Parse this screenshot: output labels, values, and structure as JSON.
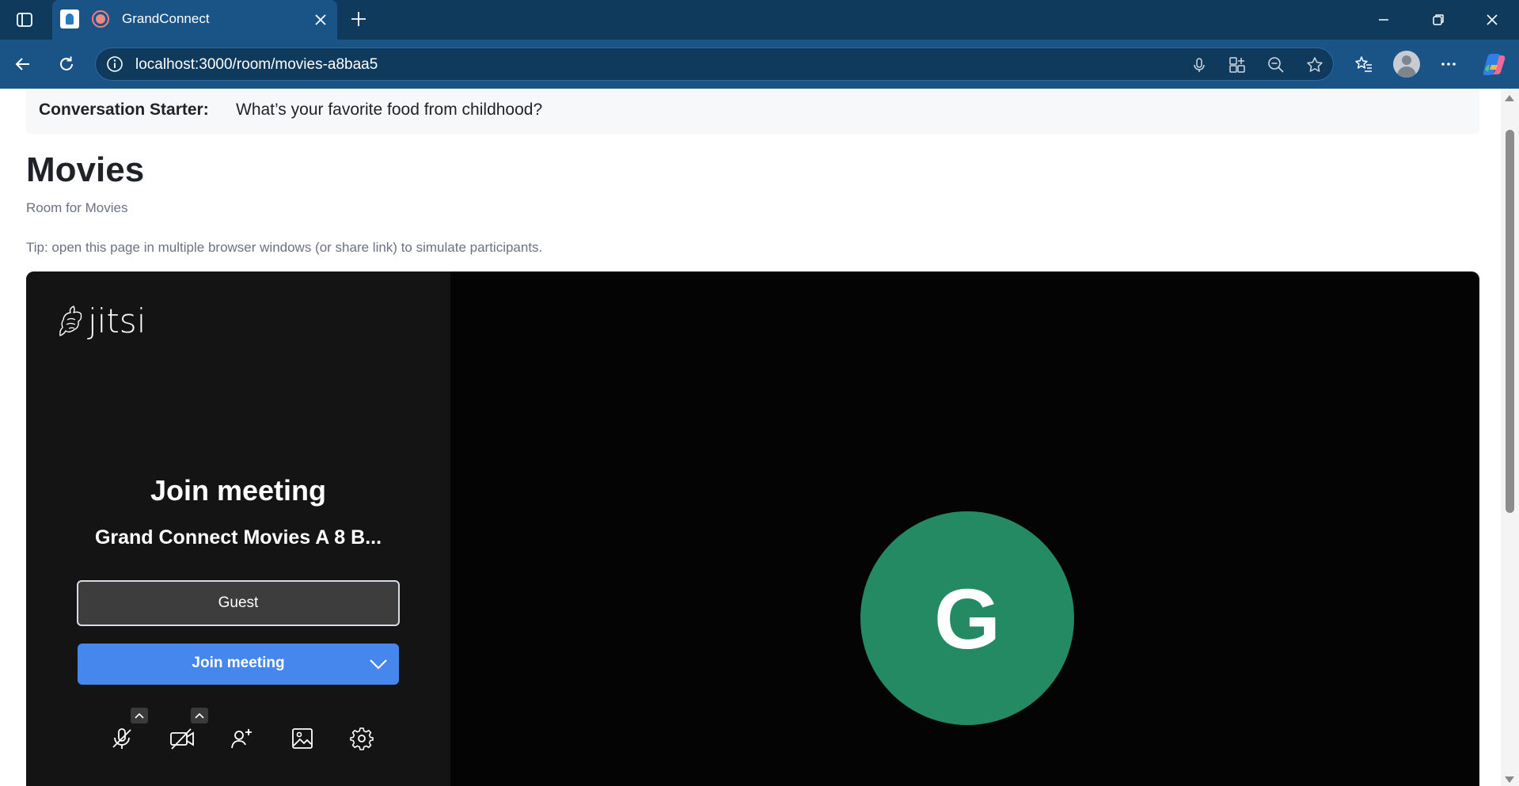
{
  "browser": {
    "tab_title": "GrandConnect",
    "url": "localhost:3000/room/movies-a8baa5"
  },
  "starter": {
    "label": "Conversation Starter:",
    "prompt": "What’s your favorite food from childhood?"
  },
  "room": {
    "title": "Movies",
    "description": "Room for Movies",
    "tip": "Tip: open this page in multiple browser windows (or share link) to simulate participants."
  },
  "prejoin": {
    "logo_text": "jitsi",
    "title": "Join meeting",
    "meeting_name": "Grand Connect Movies A 8 B...",
    "name_value": "Guest",
    "join_label": "Join meeting"
  },
  "participant": {
    "avatar_initial": "G",
    "avatar_color": "#248a63"
  },
  "colors": {
    "chrome_dark": "#0f3a5c",
    "chrome_toolbar": "#1a5386",
    "join_button": "#4687ed"
  }
}
